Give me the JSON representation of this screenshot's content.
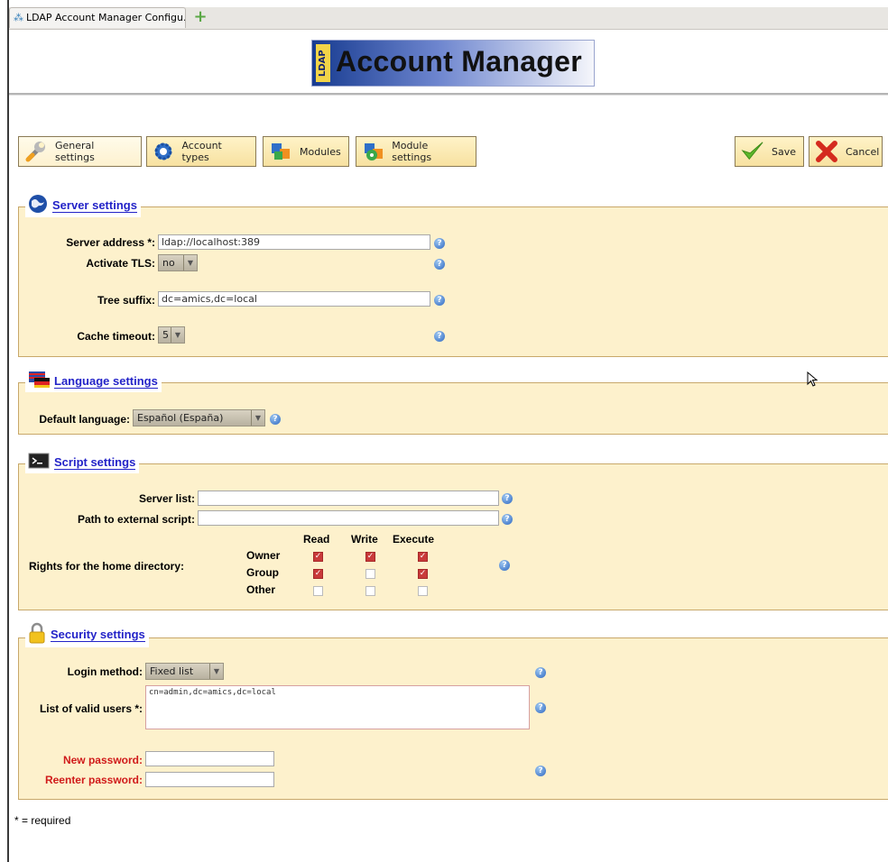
{
  "browser": {
    "tab_title": "LDAP Account Manager Configu...",
    "new_tab_glyph": "+"
  },
  "logo": {
    "badge": "LDAP",
    "title": "Account Manager"
  },
  "nav": {
    "general": "General settings",
    "account_types": "Account types",
    "modules": "Modules",
    "module_settings": "Module settings",
    "save": "Save",
    "cancel": "Cancel"
  },
  "server": {
    "legend": "Server settings",
    "address_label": "Server address *:",
    "address_value": "ldap://localhost:389",
    "tls_label": "Activate TLS:",
    "tls_value": "no",
    "suffix_label": "Tree suffix:",
    "suffix_value": "dc=amics,dc=local",
    "cache_label": "Cache timeout:",
    "cache_value": "5"
  },
  "language": {
    "legend": "Language settings",
    "default_label": "Default language:",
    "default_value": "Español (España)"
  },
  "script": {
    "legend": "Script settings",
    "server_list_label": "Server list:",
    "server_list_value": "",
    "path_label": "Path to external script:",
    "path_value": "",
    "rights_label": "Rights for the home directory:",
    "columns": [
      "Read",
      "Write",
      "Execute"
    ],
    "rows": [
      {
        "name": "Owner",
        "checks": [
          true,
          true,
          true
        ]
      },
      {
        "name": "Group",
        "checks": [
          true,
          false,
          true
        ]
      },
      {
        "name": "Other",
        "checks": [
          false,
          false,
          false
        ]
      }
    ]
  },
  "security": {
    "legend": "Security settings",
    "login_label": "Login method:",
    "login_value": "Fixed list",
    "users_label": "List of valid users *:",
    "users_value": "cn=admin,dc=amics,dc=local",
    "new_pw_label": "New password:",
    "reenter_pw_label": "Reenter password:"
  },
  "footer": {
    "required_note": "* = required"
  },
  "icons": {
    "help": "help-icon",
    "globe": "globe-icon",
    "flag": "flag-icon",
    "terminal": "terminal-icon",
    "lock": "lock-icon"
  },
  "colors": {
    "panel_bg": "#fdf1cc",
    "legend": "#2323c8",
    "required": "#d01a1a",
    "check": "#c93a3a"
  }
}
